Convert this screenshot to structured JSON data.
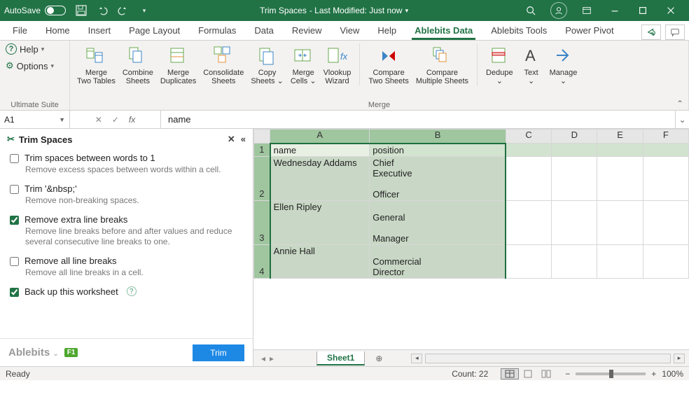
{
  "titlebar": {
    "autosave": "AutoSave",
    "doc": "Trim Spaces",
    "modified": "- Last Modified: Just now"
  },
  "tabs": [
    "File",
    "Home",
    "Insert",
    "Page Layout",
    "Formulas",
    "Data",
    "Review",
    "View",
    "Help",
    "Ablebits Data",
    "Ablebits Tools",
    "Power Pivot"
  ],
  "ribbon": {
    "help": "Help",
    "options": "Options",
    "group1_label": "Ultimate Suite",
    "buttons": [
      "Merge\nTwo Tables",
      "Combine\nSheets",
      "Merge\nDuplicates",
      "Consolidate\nSheets",
      "Copy\nSheets ⌄",
      "Merge\nCells ⌄",
      "Vlookup\nWizard",
      "Compare\nTwo Sheets",
      "Compare\nMultiple Sheets",
      "Dedupe\n⌄",
      "Text\n⌄",
      "Manage\n⌄"
    ],
    "group2_label": "Merge"
  },
  "fbar": {
    "cellref": "A1",
    "value": "name"
  },
  "panel": {
    "title": "Trim Spaces",
    "opts": [
      {
        "label": "Trim spaces between words to 1",
        "desc": "Remove excess spaces between words within a cell.",
        "checked": false
      },
      {
        "label": "Trim '&nbsp;'",
        "desc": "Remove non-breaking spaces.",
        "checked": false
      },
      {
        "label": "Remove extra line breaks",
        "desc": "Remove line breaks before and after values and reduce several consecutive line breaks to one.",
        "checked": true
      },
      {
        "label": "Remove all line breaks",
        "desc": "Remove all line breaks in a cell.",
        "checked": false
      },
      {
        "label": "Back up this worksheet",
        "desc": "",
        "checked": true,
        "help": true
      }
    ],
    "brand": "Ablebits",
    "f1": "F1",
    "trim": "Trim"
  },
  "grid": {
    "cols": [
      "A",
      "B",
      "C",
      "D",
      "E",
      "F"
    ],
    "rows": [
      {
        "n": "1",
        "a": "name",
        "b": "position",
        "hdr": true
      },
      {
        "n": "2",
        "a": "Wednesday Addams",
        "b": "Chief\nExecutive\n\nOfficer"
      },
      {
        "n": "3",
        "a": "Ellen Ripley",
        "b": "\nGeneral\n\nManager"
      },
      {
        "n": "4",
        "a": "Annie Hall",
        "b": "\nCommercial\nDirector"
      }
    ]
  },
  "sheet": {
    "name": "Sheet1"
  },
  "status": {
    "ready": "Ready",
    "count": "Count: 22",
    "zoom": "100%"
  },
  "chart_data": null
}
